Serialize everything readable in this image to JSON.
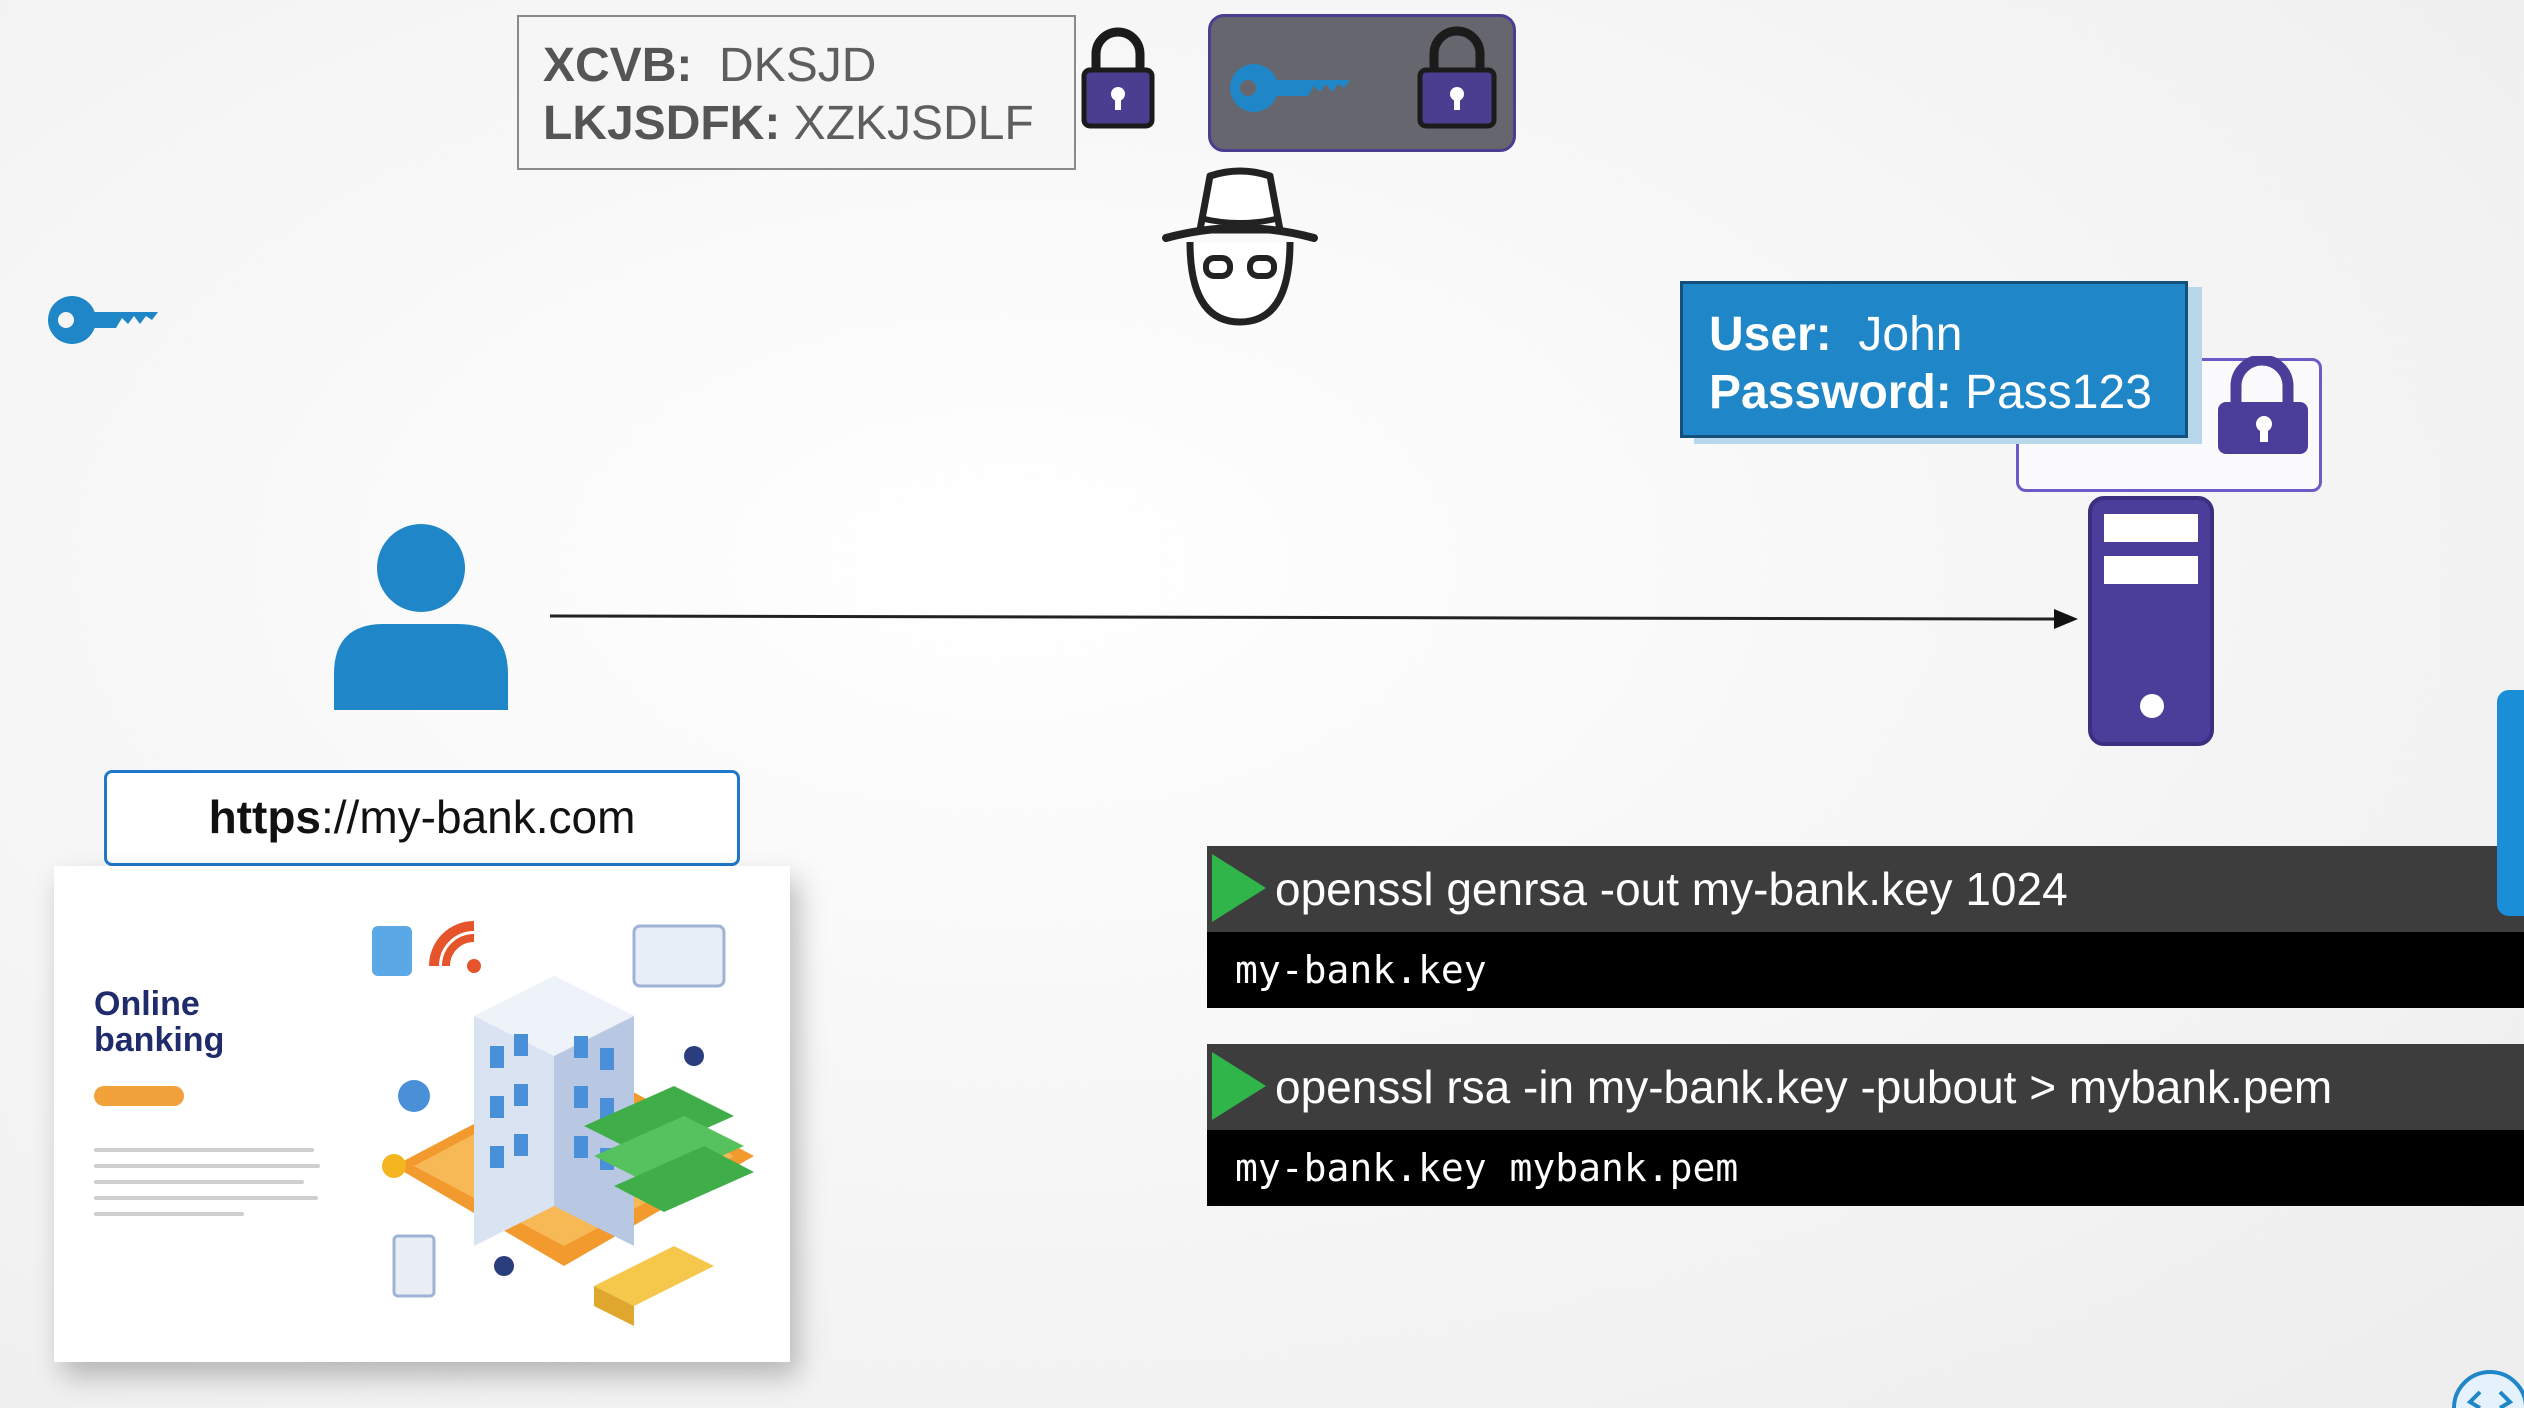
{
  "encrypted_box": {
    "line1_key": "XCVB:",
    "line1_value": "DKSJD",
    "line2_key": "LKJSDFK:",
    "line2_value": "XZKJSDLF"
  },
  "credentials": {
    "user_label": "User:",
    "user_value": "John",
    "password_label": "Password:",
    "password_value": "Pass123"
  },
  "url": {
    "scheme": "https",
    "rest": "://my-bank.com"
  },
  "website": {
    "title_line1": "Online",
    "title_line2": "banking"
  },
  "terminal": [
    {
      "command": "openssl genrsa -out my-bank.key 1024",
      "output": "my-bank.key"
    },
    {
      "command": "openssl rsa -in my-bank.key -pubout > mybank.pem",
      "output": "my-bank.key mybank.pem"
    }
  ],
  "colors": {
    "key_blue": "#1f86c8",
    "lock_purple": "#4b3d8f",
    "server_purple": "#4b3d9a",
    "user_blue": "#1f86c8",
    "play_green": "#2fb54a"
  },
  "icons": [
    "lock-icon",
    "key-icon",
    "hacker-icon",
    "user-icon",
    "server-icon",
    "play-icon"
  ]
}
